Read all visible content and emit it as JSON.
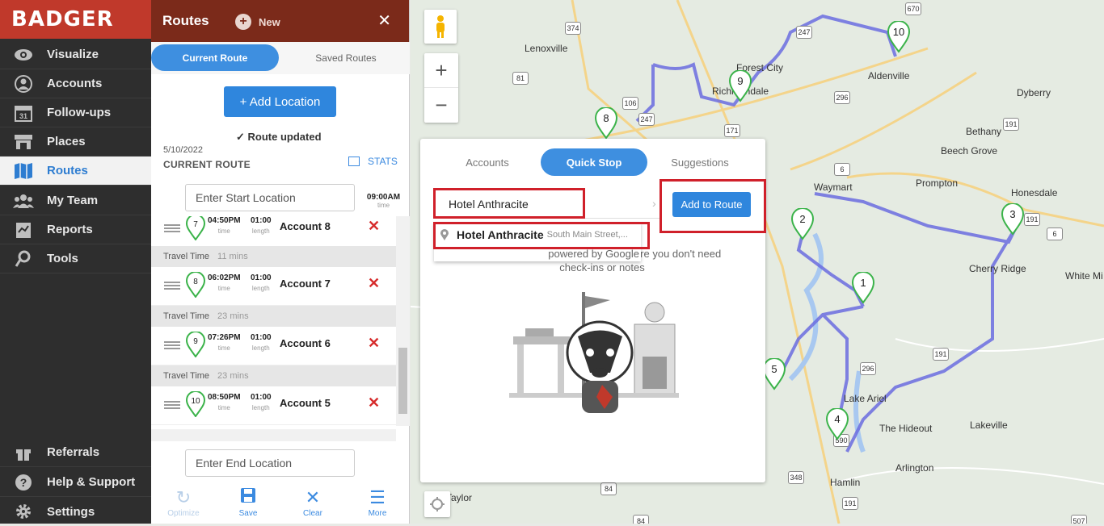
{
  "brand": {
    "logo": "BADGER",
    "color": "#c0392b"
  },
  "nav": {
    "items": [
      {
        "label": "Visualize",
        "icon": "eye-icon"
      },
      {
        "label": "Accounts",
        "icon": "user-icon"
      },
      {
        "label": "Follow-ups",
        "icon": "calendar-icon"
      },
      {
        "label": "Places",
        "icon": "store-icon"
      },
      {
        "label": "Routes",
        "icon": "map-icon",
        "active": true
      },
      {
        "label": "My Team",
        "icon": "team-icon"
      },
      {
        "label": "Reports",
        "icon": "report-icon"
      },
      {
        "label": "Tools",
        "icon": "tools-icon"
      }
    ],
    "bottom": [
      {
        "label": "Referrals",
        "icon": "gift-icon"
      },
      {
        "label": "Help & Support",
        "icon": "help-icon"
      },
      {
        "label": "Settings",
        "icon": "gear-icon"
      }
    ],
    "calendar_day": "31"
  },
  "panel": {
    "title": "Routes",
    "new_label": "New",
    "close": "✕",
    "tabs": {
      "current": "Current Route",
      "saved": "Saved Routes"
    },
    "add_location": "+ Add Location",
    "status": "Route updated",
    "date": "5/10/2022",
    "route_title": "CURRENT ROUTE",
    "stats": "STATS",
    "start_placeholder": "Enter Start Location",
    "start_time": "09:00AM",
    "time_label": "time",
    "end_placeholder": "Enter End Location",
    "stops": [
      {
        "num": "7",
        "time": "04:50PM",
        "length": "01:00",
        "account": "Account 8"
      },
      {
        "num": "8",
        "time": "06:02PM",
        "length": "01:00",
        "account": "Account 7"
      },
      {
        "num": "9",
        "time": "07:26PM",
        "length": "01:00",
        "account": "Account 6"
      },
      {
        "num": "10",
        "time": "08:50PM",
        "length": "01:00",
        "account": "Account 5"
      }
    ],
    "travel": [
      {
        "label": "Travel Time",
        "value": "11 mins"
      },
      {
        "label": "Travel Time",
        "value": "23 mins"
      },
      {
        "label": "Travel Time",
        "value": "23 mins"
      }
    ],
    "sub_time": "time",
    "sub_length": "length",
    "bottom": [
      {
        "label": "Optimize",
        "icon": "optimize-icon"
      },
      {
        "label": "Save",
        "icon": "save-icon"
      },
      {
        "label": "Clear",
        "icon": "clear-icon"
      },
      {
        "label": "More",
        "icon": "menu-icon"
      }
    ]
  },
  "popup": {
    "tabs": [
      "Accounts",
      "Quick Stop",
      "Suggestions"
    ],
    "search_value": "Hotel Anthracite",
    "add_button": "Add to Route",
    "suggestion": {
      "name": "Hotel Anthracite",
      "address": "South Main Street,..."
    },
    "powered": "powered by Google",
    "desc": "...ot be saved as an account) where you don't need check-ins or notes"
  },
  "map": {
    "places": [
      "Lenoxville",
      "Forest City",
      "Richmondale",
      "Aldenville",
      "Dyberry",
      "Bethany",
      "Beech Grove",
      "Waymart",
      "Prompton",
      "Honesdale",
      "Cherry Ridge",
      "White Mi",
      "Lake Ariel",
      "The Hideout",
      "Lakeville",
      "Arlington",
      "Hamlin",
      "Taylor"
    ],
    "shields": [
      "374",
      "670",
      "247",
      "296",
      "81",
      "106",
      "247",
      "171",
      "191",
      "6",
      "6",
      "191",
      "296",
      "191",
      "590",
      "348",
      "191",
      "84",
      "84",
      "507"
    ],
    "markers": [
      "10",
      "9",
      "8",
      "2",
      "3",
      "1",
      "5",
      "4"
    ],
    "route_color": "#6b6de0"
  }
}
